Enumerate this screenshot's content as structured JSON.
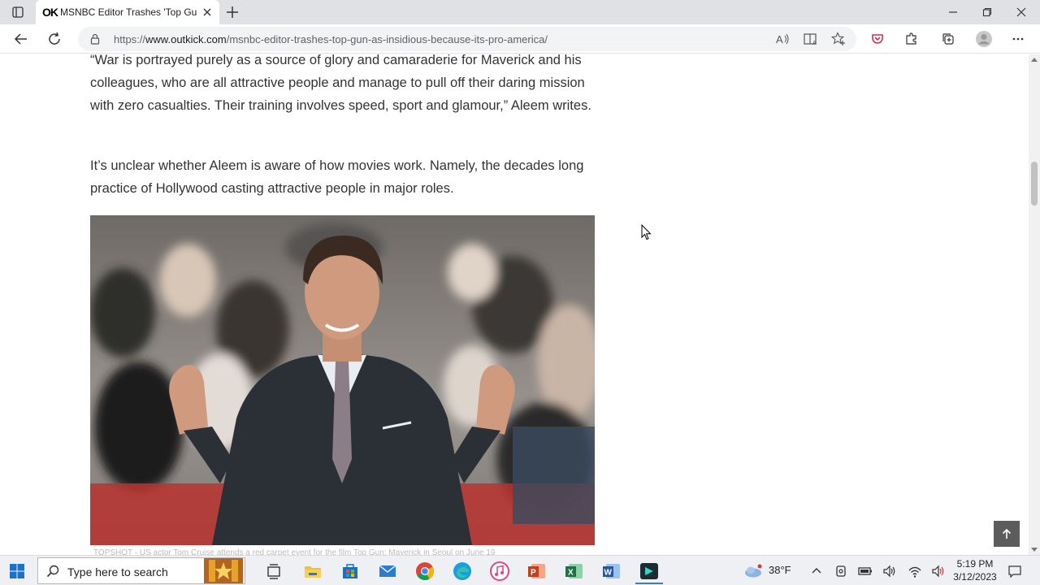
{
  "browser": {
    "tab_title": "MSNBC Editor Trashes 'Top Gun",
    "tab_favicon_text": "OK",
    "url_prefix": "https://",
    "url_host": "www.outkick.com",
    "url_path": "/msnbc-editor-trashes-top-gun-as-insidious-because-its-pro-america/",
    "accent_color": "#ffffff"
  },
  "article": {
    "paragraph_1": "“War is portrayed purely as a source of glory and camaraderie for Maverick and his colleagues, who are all attractive people and manage to pull off their daring mission with zero casualties. Their training involves speed, sport and glamour,” Aleem writes.",
    "paragraph_2": "It’s unclear whether Aleem is aware of how movies work. Namely, the decades long practice of Hollywood casting attractive people in major roles.",
    "photo_caption": "TOPSHOT - US actor Tom Cruise attends a red carpet event for the film Top Gun: Maverick in Seoul on June 19"
  },
  "taskbar": {
    "search_placeholder": "Type here to search",
    "temperature": "38°F",
    "time": "5:19 PM",
    "date": "3/12/2023"
  },
  "icons": [
    "tab-actions-icon",
    "close-icon",
    "plus-icon",
    "minimize-icon",
    "restore-icon",
    "back-icon",
    "refresh-icon",
    "lock-icon",
    "read-aloud-icon",
    "immersive-reader-icon",
    "favorite-icon",
    "pocket-icon",
    "extensions-icon",
    "collections-icon",
    "profile-icon",
    "more-icon",
    "arrow-up-icon",
    "windows-icon",
    "search-icon",
    "task-view-icon",
    "file-explorer-icon",
    "store-icon",
    "mail-icon",
    "chrome-icon",
    "edge-icon",
    "itunes-icon",
    "powerpoint-icon",
    "excel-icon",
    "word-icon",
    "filmora-icon",
    "weather-icon",
    "chevron-up-icon",
    "network-icon",
    "volume-icon",
    "notification-icon"
  ]
}
